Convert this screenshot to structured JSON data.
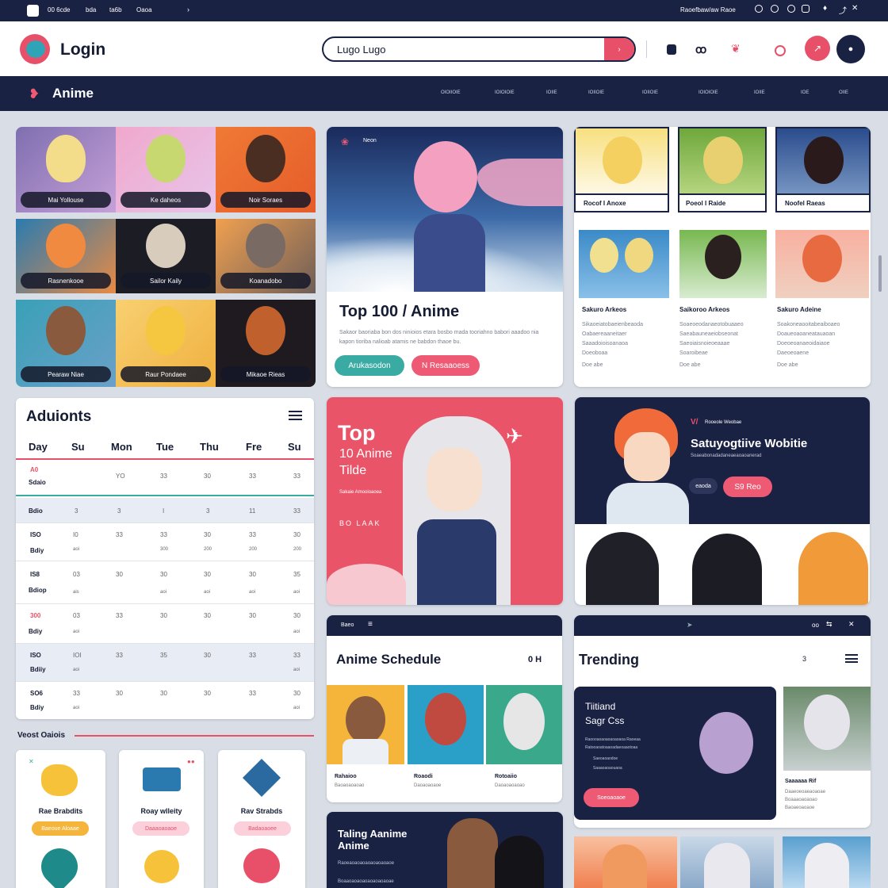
{
  "topbar": {
    "left_items": [
      "00 6cde",
      "bda",
      "ta6b",
      "Oaoa"
    ],
    "right_text": "Raoefbaw/aw Raoe"
  },
  "header": {
    "brand": "Login",
    "search_value": "Lugo Lugo"
  },
  "nav": {
    "brand": "Anime",
    "items": [
      "OIOIIOIE",
      "IOIOIOIE",
      "IOIIE",
      "IOIIOIE",
      "IOIIOIE",
      "IOIOIOIE",
      "IOIIE",
      "IOE",
      "OIIE"
    ]
  },
  "grid_tiles": [
    "Mai Yollouse",
    "Ke daheos",
    "Noir Soraes",
    "Rasnenkooe",
    "Sailor Kaily",
    "Koanadobo",
    "Pearaw Niae",
    "Raur Pondaee",
    "Mikaoe Rieas"
  ],
  "hero": {
    "tag": "Neon",
    "title": "Top 100 / Anime",
    "desc": "Sakaor baoriaba bon dos ninioios etara bosbo mada tooriahno babori aaadoo nia kapon tioriba nalioab atamis ne babdon thaoe bu.",
    "btn1": "Arukasodon",
    "btn2": "N Resaaoess"
  },
  "cast": {
    "top": [
      {
        "label": "Rocof I Anoxe"
      },
      {
        "label": "Poeol I Raide"
      },
      {
        "label": "Noofel Raeas"
      }
    ],
    "bottom": [
      {
        "title": "Sakuro Arkeos",
        "lines": [
          "Sikaoeiatobaeienbeaoda",
          "Oabaereaaneitaer",
          "Saaadoioisoanaoa",
          "Doeoboaa",
          "Doe abe"
        ]
      },
      {
        "title": "Saikoroo Arkeos",
        "lines": [
          "Soaeoeodanaeotobuaaeo",
          "Saeabauneaeiobseonat",
          "Saeoiaisnoieoeaaae",
          "Soaroibeae",
          "Doe abe"
        ]
      },
      {
        "title": "Sakuro Adeine",
        "lines": [
          "Soakoneaooitabeaiboaeo",
          "Doaueoaoaneatauaoan",
          "Doeoeoanaeoidaiaoe",
          "Daeoeoaene",
          "Doe abe"
        ]
      }
    ]
  },
  "calendar": {
    "title": "Aduionts",
    "headers": [
      "Day",
      "Su",
      "Mon",
      "Tue",
      "Thu",
      "Fre",
      "Su"
    ],
    "rows": [
      {
        "a": "A0",
        "b": "Sdaio",
        "cells": [
          "",
          "YO",
          "33",
          "30",
          "33",
          "33"
        ],
        "subs": [
          "",
          "",
          "",
          "",
          "",
          ""
        ]
      },
      {
        "a": "Bdio",
        "b": "",
        "cells": [
          "3",
          "3",
          "I",
          "3",
          "11",
          "33"
        ],
        "subs": [
          "",
          "",
          "",
          "",
          "",
          ""
        ]
      },
      {
        "a": "ISO",
        "b": "Bdiy",
        "cells": [
          "I0",
          "33",
          "33",
          "30",
          "33",
          "30"
        ],
        "subs": [
          "aoi",
          "",
          "300",
          "200",
          "200",
          "200"
        ]
      },
      {
        "a": "IS8",
        "b": "Bdiop",
        "cells": [
          "03",
          "30",
          "30",
          "30",
          "30",
          "35"
        ],
        "subs": [
          "ais",
          "",
          "aoi",
          "aoi",
          "aoi",
          "aoi"
        ]
      },
      {
        "a": "300",
        "b": "Bdiy",
        "cells": [
          "03",
          "33",
          "30",
          "30",
          "30",
          "30"
        ],
        "subs": [
          "aoi",
          "",
          "",
          "",
          "",
          "aoi"
        ]
      },
      {
        "a": "ISO",
        "b": "Bdiiy",
        "cells": [
          "IOI",
          "33",
          "35",
          "30",
          "33",
          "33"
        ],
        "subs": [
          "aoi",
          "",
          "",
          "",
          "",
          "aoi"
        ]
      },
      {
        "a": "SO6",
        "b": "Bdiy",
        "cells": [
          "33",
          "30",
          "30",
          "30",
          "33",
          "30"
        ],
        "subs": [
          "aoi",
          "",
          "",
          "",
          "",
          "aoi"
        ]
      }
    ]
  },
  "vest": {
    "title": "Veost Oaiois",
    "items": [
      {
        "name": "Rae Brabdits",
        "btn": "Baeoue Aloaae"
      },
      {
        "name": "Roay wlleity",
        "btn": "Daaaoaoaoe"
      },
      {
        "name": "Rav Strabds",
        "btn": "Badaoaoee"
      }
    ]
  },
  "poster": {
    "line1": "Top",
    "line2": "10 Anime",
    "line3": "Tilde",
    "sub": "Sakaie Amooioaoea",
    "sig": "BO LAAK"
  },
  "website": {
    "tag": "Rooeole Weobae",
    "title": "Satuyogtiive Wobitie",
    "desc": "Soaeabonadadaneaeaoaoanerad",
    "link": "eaoda",
    "btn": "S9 Reo"
  },
  "schedule": {
    "bar": "Baeo",
    "title": "Anime Schedule",
    "icons": "0  H",
    "cards": [
      {
        "name": "Rahaioo",
        "sub": "Baoaoaoaoao"
      },
      {
        "name": "Roaodi",
        "sub": "Daoaoaoaoe"
      },
      {
        "name": "Rotoaiio",
        "sub": "Daoaoaoaoao"
      }
    ]
  },
  "trending": {
    "bar": "oo",
    "title": "Trending",
    "count": "3",
    "card_title1": "Tiitiand",
    "card_title2": "Sagr Css",
    "lines": [
      "Raoooaoaoaoaoaoaoa Raoeaa",
      "Ratooaoatoaaoadaeoaaotoaa",
      "Saeoaoaodoe",
      "Saaaoaoaouaoa"
    ],
    "btn": "Soeoaoaoe",
    "side_name": "Saaaaaa Rif",
    "side_lines": [
      "Daaeoeoaeaoaoae",
      "Boaaaoaoaoao",
      "Baoaeoaoaoe"
    ]
  },
  "tailing": {
    "title1": "Taling Aanime",
    "title2": "Anime",
    "desc": "Raoeaoaoaoaoaoaoaoaoe",
    "desc2": "Boaaoaoaoaoaoaoaoaoae"
  },
  "colors": {
    "navy": "#1a2244",
    "pink": "#ee5a74",
    "teal": "#3aaba3",
    "red": "#e8506a"
  }
}
